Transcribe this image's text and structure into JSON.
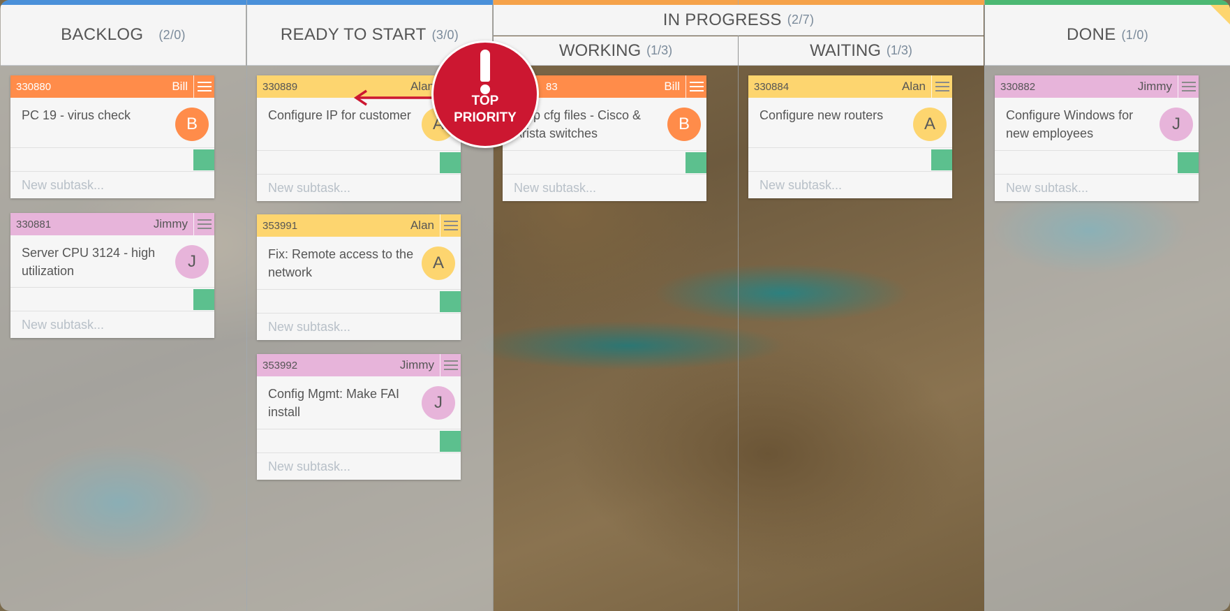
{
  "columns": {
    "backlog": {
      "title": "BACKLOG",
      "count": "(2/0)"
    },
    "ready": {
      "title": "READY TO START",
      "count": "(3/0)"
    },
    "in_progress": {
      "title": "IN PROGRESS",
      "count": "(2/7)"
    },
    "working": {
      "title": "WORKING",
      "count": "(1/3)"
    },
    "waiting": {
      "title": "WAITING",
      "count": "(1/3)"
    },
    "done": {
      "title": "DONE",
      "count": "(1/0)"
    }
  },
  "colors": {
    "backlog_bar": "#4a90d9",
    "ready_bar": "#4a90d9",
    "in_progress_bar": "#f5a24a",
    "done_bar": "#4cb873",
    "priority": "#cc1731",
    "tag_green": "#5cc08e"
  },
  "cards": {
    "c330880": {
      "id": "330880",
      "owner": "Bill",
      "title": "PC 19 - virus check",
      "avatar": "B",
      "subtask": "New subtask..."
    },
    "c330881": {
      "id": "330881",
      "owner": "Jimmy",
      "title": "Server CPU 3124 - high utilization",
      "avatar": "J",
      "subtask": "New subtask..."
    },
    "c330889": {
      "id": "330889",
      "owner": "Alan",
      "title": "Configure IP for customer",
      "avatar": "A",
      "subtask": "New subtask..."
    },
    "c353991": {
      "id": "353991",
      "owner": "Alan",
      "title": "Fix: Remote access to the network",
      "avatar": "A",
      "subtask": "New subtask..."
    },
    "c353992": {
      "id": "353992",
      "owner": "Jimmy",
      "title": "Config Mgmt: Make FAI install",
      "avatar": "J",
      "subtask": "New subtask..."
    },
    "c330883": {
      "id": "3308",
      "id_visible": "83",
      "owner": "Bill",
      "title": "ckup cfg files - Cisco & Arista switches",
      "avatar": "B",
      "subtask": "New subtask..."
    },
    "c330884": {
      "id": "330884",
      "owner": "Alan",
      "title": "Configure new routers",
      "avatar": "A",
      "subtask": "New subtask..."
    },
    "c330882": {
      "id": "330882",
      "owner": "Jimmy",
      "title": "Configure Windows for new employees",
      "avatar": "J",
      "subtask": "New subtask..."
    }
  },
  "priority_badge": {
    "line1": "TOP",
    "line2": "PRIORITY",
    "icon": "exclamation-icon"
  }
}
